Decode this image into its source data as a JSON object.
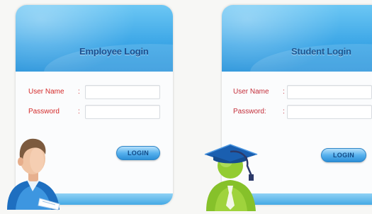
{
  "employee": {
    "title": "Employee Login",
    "username_label": "User Name",
    "password_label": "Password",
    "colon": ":",
    "login_label": "LOGIN"
  },
  "student": {
    "title": "Student Login",
    "username_label": "User Name",
    "password_label": "Password:",
    "colon": ":",
    "login_label": "LOGIN"
  }
}
